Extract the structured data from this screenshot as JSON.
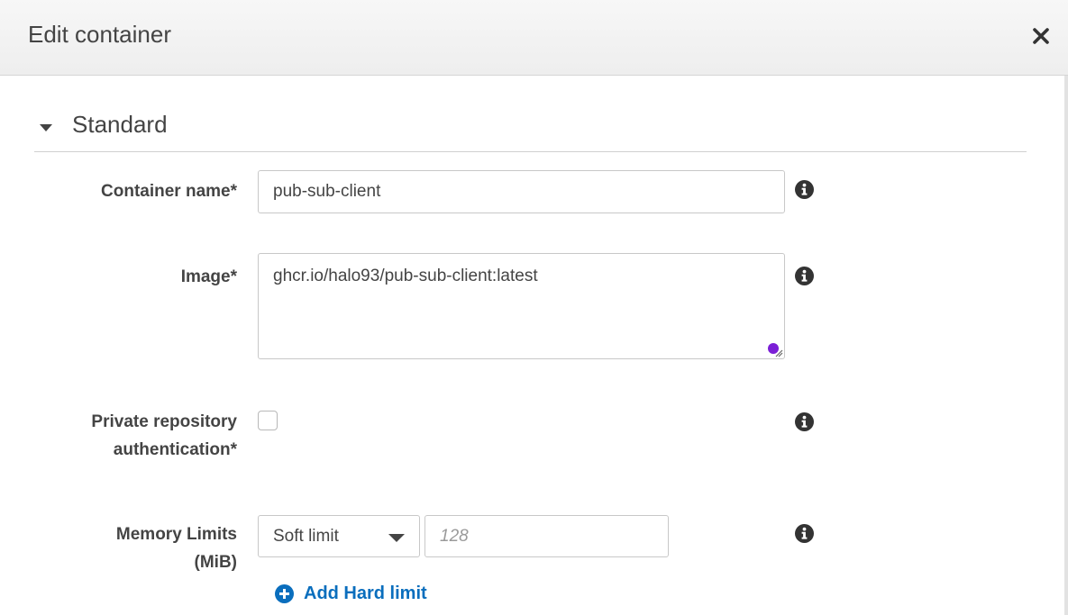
{
  "modal": {
    "title": "Edit container"
  },
  "section": {
    "title": "Standard"
  },
  "fields": {
    "container_name": {
      "label": "Container name*",
      "value": "pub-sub-client"
    },
    "image": {
      "label": "Image*",
      "value": "ghcr.io/halo93/pub-sub-client:latest"
    },
    "private_repo": {
      "label_line1": "Private repository",
      "label_line2": "authentication*",
      "checked": false
    },
    "memory": {
      "label_line1": "Memory Limits",
      "label_line2": "(MiB)",
      "limit_type": "Soft limit",
      "placeholder": "128",
      "add_link": "Add Hard limit"
    }
  },
  "icons": {
    "close": "close-icon",
    "section_toggle": "caret-down-icon",
    "info": "info-icon",
    "add": "plus-circle-icon"
  },
  "colors": {
    "link": "#0a6ebd",
    "text": "#444444",
    "resize_handle": "#7b1fd6"
  }
}
